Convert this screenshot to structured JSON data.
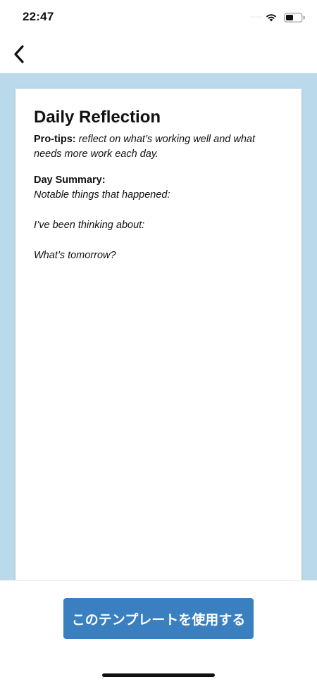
{
  "status_bar": {
    "time": "22:47",
    "signal_dots": "·····",
    "icons": [
      "wifi-icon",
      "battery-icon"
    ]
  },
  "nav": {
    "back_icon": "chevron-left-icon"
  },
  "template": {
    "title": "Daily Reflection",
    "pro_tips_label": "Pro-tips:",
    "pro_tips_text": "reflect on what’s working well and what needs more work each day.",
    "section_heading": "Day Summary:",
    "prompts": [
      "Notable things that happened:",
      "I’ve been thinking about:",
      "What’s tomorrow?"
    ]
  },
  "footer": {
    "use_template_label": "このテンプレートを使用する"
  },
  "colors": {
    "preview_background": "#bad9ea",
    "button": "#3a7fbf",
    "card": "#ffffff"
  }
}
